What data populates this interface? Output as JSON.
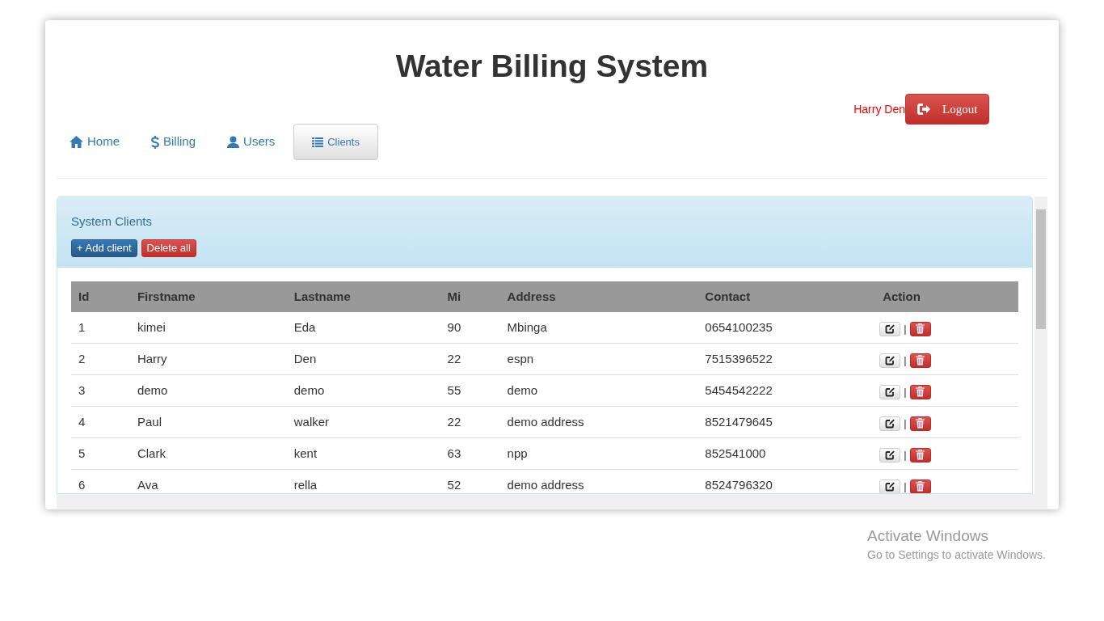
{
  "title": "Water Billing System",
  "user": {
    "name": "Harry Den",
    "logout": "Logout"
  },
  "nav": [
    {
      "label": "Home",
      "kind": "home",
      "selected": false
    },
    {
      "label": "Billing",
      "kind": "dollar",
      "selected": false
    },
    {
      "label": "Users",
      "kind": "user",
      "selected": false
    },
    {
      "label": "Clients",
      "kind": "list",
      "selected": true
    }
  ],
  "panel": {
    "title": "System Clients",
    "add_button": "+ Add client",
    "delete_all_button": "Delete all"
  },
  "table": {
    "columns": [
      "Id",
      "Firstname",
      "Lastname",
      "Mi",
      "Address",
      "Contact",
      "Action"
    ],
    "rows": [
      {
        "cells": [
          "1",
          "kimei",
          "Eda",
          "90",
          "Mbinga",
          "0654100235"
        ],
        "separator": "|"
      },
      {
        "cells": [
          "2",
          "Harry",
          "Den",
          "22",
          "espn",
          "7515396522"
        ],
        "separator": "|"
      },
      {
        "cells": [
          "3",
          "demo",
          "demo",
          "55",
          "demo",
          "5454542222"
        ],
        "separator": "|"
      },
      {
        "cells": [
          "4",
          "Paul",
          "walker",
          "22",
          "demo address",
          "8521479645"
        ],
        "separator": "|"
      },
      {
        "cells": [
          "5",
          "Clark",
          "kent",
          "63",
          "npp",
          "852541000"
        ],
        "separator": "|"
      },
      {
        "cells": [
          "6",
          "Ava",
          "rella",
          "52",
          "demo address",
          "8524796320"
        ],
        "separator": "|"
      }
    ]
  },
  "activation": {
    "title": "Activate Windows",
    "subtitle": "Go to Settings to activate Windows."
  }
}
